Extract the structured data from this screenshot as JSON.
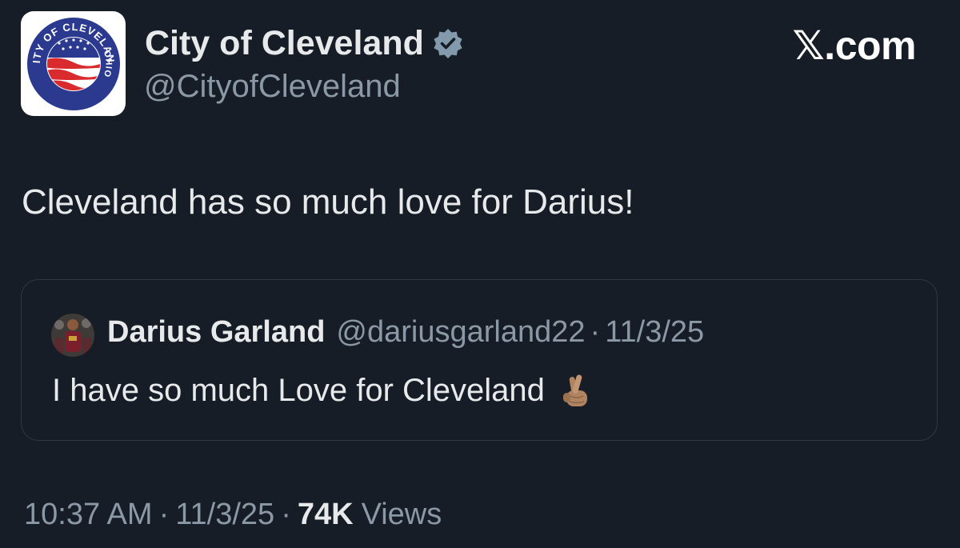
{
  "colors": {
    "background": "#161d27",
    "text_primary": "#e7e9ea",
    "text_secondary": "#8b98a5",
    "verified_badge": "#829aab",
    "border": "#2f3943",
    "seal_blue": "#2b3a8f",
    "seal_red": "#d92a2e"
  },
  "author": {
    "avatar_icon": "city-of-cleveland-seal",
    "avatar_seal_text": {
      "top": "CITY OF CLEVELAND",
      "right": "OHIO"
    },
    "display_name": "City of Cleveland",
    "verified_icon": "verified-badge-icon",
    "handle": "@CityofCleveland"
  },
  "brand": {
    "label": "𝕏.com"
  },
  "tweet": {
    "text": "Cleveland has so much love for Darius!"
  },
  "quote": {
    "author_name": "Darius Garland",
    "author_handle": "@dariusgarland22",
    "separator": "·",
    "date": "11/3/25",
    "text": "I have so much Love for Cleveland",
    "emoji_icon": "crossed-fingers-emoji"
  },
  "meta": {
    "time": "10:37 AM",
    "separator1": "·",
    "date": "11/3/25",
    "separator2": "·",
    "views_count": "74K",
    "views_label": "Views"
  }
}
